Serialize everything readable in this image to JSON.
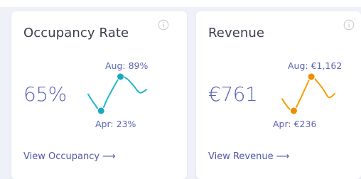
{
  "colors": {
    "accent": "#5b63b5",
    "occupancy_line": "#1fb7c9",
    "occupancy_dot": "#16a9bb",
    "revenue_line": "#f5a000",
    "revenue_dot": "#ee8d00",
    "background": "#eef1f8"
  },
  "cards": [
    {
      "title": "Occupancy Rate",
      "info_icon": "info-icon",
      "value": "65%",
      "spark_high_label": "Aug: 89%",
      "spark_low_label": "Apr: 23%",
      "link_label": "View Occupancy",
      "link_icon": "arrow-right-icon",
      "link_arrow": "⟶",
      "trend": [
        55,
        36,
        23,
        47,
        70,
        89,
        85,
        72,
        58,
        64
      ]
    },
    {
      "title": "Revenue",
      "info_icon": "info-icon",
      "value": "€761",
      "spark_high_label": "Aug: €1,162",
      "spark_low_label": "Apr: €236",
      "link_label": "View Revenue",
      "link_icon": "arrow-right-icon",
      "link_arrow": "⟶",
      "trend": [
        560,
        330,
        236,
        520,
        860,
        1162,
        1030,
        830,
        600,
        700
      ]
    }
  ]
}
